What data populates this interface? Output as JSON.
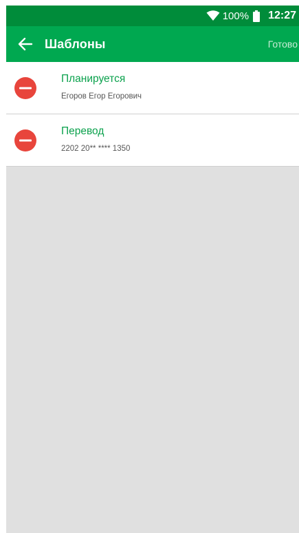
{
  "status_bar": {
    "battery_percent": "100%",
    "time": "12:27",
    "wifi_icon": "wifi-icon",
    "battery_icon": "battery-icon"
  },
  "app_bar": {
    "title": "Шаблоны",
    "done_label": "Готово",
    "back_icon": "arrow-back-icon"
  },
  "templates": [
    {
      "title": "Планируется",
      "subtitle": "Егоров Егор Егорович"
    },
    {
      "title": "Перевод",
      "subtitle": "2202 20** **** 1350"
    }
  ],
  "colors": {
    "status_bar": "#008c3a",
    "app_bar": "#00a850",
    "item_title": "#0aa14c",
    "remove_button": "#e8453c",
    "background": "#e0e0e0"
  }
}
